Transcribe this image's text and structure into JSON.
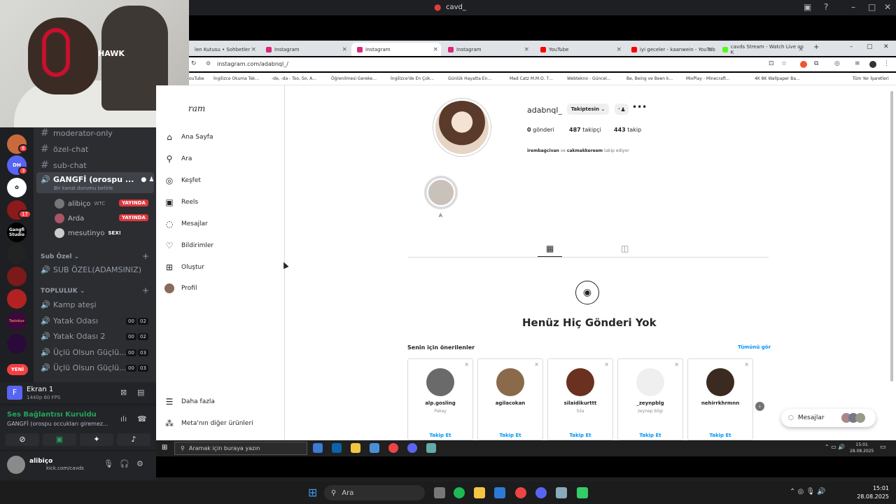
{
  "window": {
    "title": "cavd_"
  },
  "webcam": {
    "cap_text": "HAWK"
  },
  "servers": [
    {
      "badge": "6",
      "color": "#c86a3c"
    },
    {
      "badge": "3",
      "label": "DH",
      "color": "#5865f2"
    },
    {
      "badge": "",
      "color": "#ffffff"
    },
    {
      "badge": "17",
      "color": "#8b1a1a"
    },
    {
      "badge": "",
      "label": "Gangfi Studio",
      "color": "#000000"
    },
    {
      "badge": "",
      "color": "#222222"
    },
    {
      "badge": "",
      "color": "#7a1a1a"
    },
    {
      "badge": "",
      "color": "#b22222"
    },
    {
      "badge": "",
      "label": "Twinkur",
      "color": "#3a0a3a"
    },
    {
      "badge": "",
      "color": "#2a0a3a"
    },
    {
      "badge": "",
      "label": "YENİ",
      "color": "#5865f2"
    }
  ],
  "channels": {
    "text": [
      "moderator-only",
      "özel-chat",
      "sub-chat"
    ],
    "active_voice": {
      "name": "GANGFİ (orospu ...",
      "status": "Bir kanal durumu belirle"
    },
    "voice_users": [
      {
        "name": "alibiço",
        "tag": "WTC",
        "live": "YAYINDA"
      },
      {
        "name": "Arda",
        "tag": "",
        "live": "YAYINDA"
      },
      {
        "name": "mesutinyo",
        "tag": "SEX!",
        "live": ""
      }
    ],
    "cat_sub": "Sub Özel",
    "sub_channels": [
      "SUB ÖZEL(ADAMSINIZ)"
    ],
    "cat_topluluk": "TOPLULUK",
    "topluluk": [
      {
        "name": "Kamp ateşi",
        "c1": "",
        "c2": ""
      },
      {
        "name": "Yatak Odası",
        "c1": "00",
        "c2": "02"
      },
      {
        "name": "Yatak Odası 2",
        "c1": "00",
        "c2": "02"
      },
      {
        "name": "Üçlü Olsun Güçlü...",
        "c1": "00",
        "c2": "03"
      },
      {
        "name": "Üçlü Olsun Güçlü...",
        "c1": "00",
        "c2": "03"
      }
    ]
  },
  "ekran": {
    "title": "Ekran 1",
    "sub": "1440p 60 FPS"
  },
  "voice_conn": {
    "status": "Ses Bağlantısı Kuruldu",
    "channel": "GANGFİ (orospu occukları giremez..."
  },
  "userpanel": {
    "name": "alibiço",
    "sub": "kick.com/cavds"
  },
  "browser": {
    "tabs": [
      {
        "label": "len Kutusu • Sohbetler",
        "color": "#888888"
      },
      {
        "label": "Instagram",
        "color": "#d62976"
      },
      {
        "label": "Instagram",
        "color": "#d62976"
      },
      {
        "label": "Instagram",
        "color": "#d62976"
      },
      {
        "label": "YouTube",
        "color": "#ff0000"
      },
      {
        "label": "iyi geceler - kaanwein - YouTub",
        "color": "#ff0000"
      },
      {
        "label": "cavds Stream - Watch Live on K",
        "color": "#53fc18"
      }
    ],
    "url": "instagram.com/adabnql_/",
    "bookmarks": [
      "ouTube",
      "İngilizce Okuma Tek...",
      "-de, -da - Too, So, A...",
      "Öğrenilmesi Gereke...",
      "İngilizce'de En Çok...",
      "Günlük Hayatta En...",
      "Mad Catz M.M.O. 7...",
      "Webtekno - Güncel...",
      "Be, Being ve Been k...",
      "MixPlay - Minecraft...",
      "4K 8K Wallpaper Ba...",
      "Tüm Yer İşaretleri"
    ]
  },
  "ig": {
    "logo": "ram",
    "nav": [
      "Ana Sayfa",
      "Ara",
      "Keşfet",
      "Reels",
      "Mesajlar",
      "Bildirimler",
      "Oluştur",
      "Profil"
    ],
    "nav_bottom": [
      "Daha fazla",
      "Meta'nın diğer ürünleri"
    ],
    "username": "adabnql_",
    "follow_btn": "Takiptesin",
    "posts": "0",
    "posts_label": "gönderi",
    "followers": "487",
    "followers_label": "takipçi",
    "following": "443",
    "following_label": "takip",
    "mutual_a": "irembagcivan",
    "mutual_ve": "ve",
    "mutual_b": "cakmakkereem",
    "mutual_tail": "takip ediyor",
    "highlight": "A",
    "no_posts": "Henüz Hiç Gönderi Yok",
    "suggestions_title": "Senin için önerilenler",
    "see_all": "Tümünü gör",
    "cards": [
      {
        "name": "alp.gosling",
        "sub": "Pakay",
        "follow": "Takip Et",
        "color": "#6a6a6a"
      },
      {
        "name": "agilacokan",
        "sub": "",
        "follow": "Takip Et",
        "color": "#8a6a4a"
      },
      {
        "name": "silaidikurttt",
        "sub": "Sıla",
        "follow": "Takip Et",
        "color": "#6a3020"
      },
      {
        "name": "_zeynpblg",
        "sub": "zeynep bilgi",
        "follow": "Takip Et",
        "color": "#efefef"
      },
      {
        "name": "nehirrkhrmnn",
        "sub": "",
        "follow": "Takip Et",
        "color": "#3a2a20"
      }
    ],
    "messages": "Mesajlar"
  },
  "inner_taskbar": {
    "search": "Aramak için buraya yazın",
    "time": "15:01",
    "date": "28.08.2025"
  },
  "outer_taskbar": {
    "search": "Ara",
    "time": "15:01",
    "date": "28.08.2025"
  }
}
